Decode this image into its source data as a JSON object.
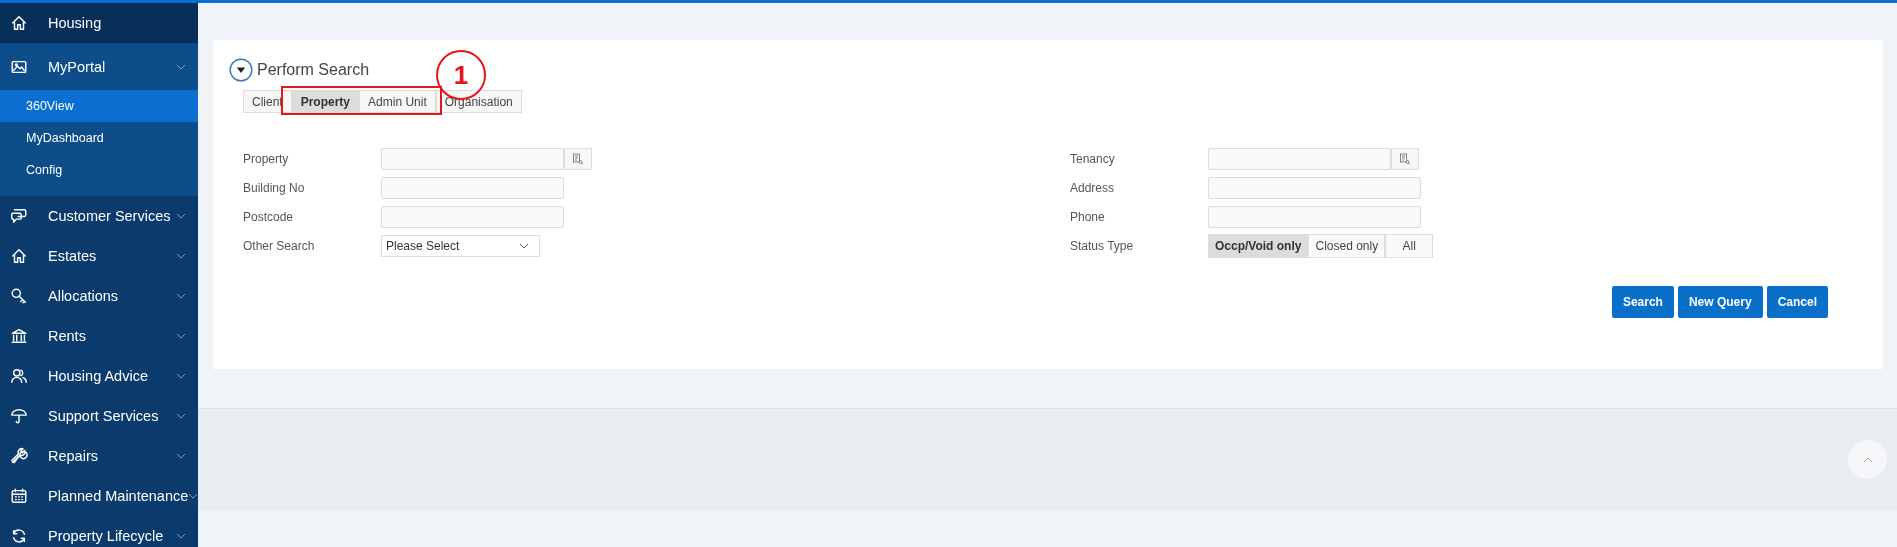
{
  "sidebar": {
    "items": [
      {
        "label": "Housing",
        "kind": "link"
      },
      {
        "label": "MyPortal",
        "kind": "group",
        "expanded": true,
        "children": [
          {
            "label": "360View",
            "selected": true
          },
          {
            "label": "MyDashboard",
            "selected": false
          },
          {
            "label": "Config",
            "selected": false
          }
        ]
      },
      {
        "label": "Customer Services",
        "kind": "group",
        "expanded": false
      },
      {
        "label": "Estates",
        "kind": "group",
        "expanded": false
      },
      {
        "label": "Allocations",
        "kind": "group",
        "expanded": false
      },
      {
        "label": "Rents",
        "kind": "group",
        "expanded": false
      },
      {
        "label": "Housing Advice",
        "kind": "group",
        "expanded": false
      },
      {
        "label": "Support Services",
        "kind": "group",
        "expanded": false
      },
      {
        "label": "Repairs",
        "kind": "group",
        "expanded": false
      },
      {
        "label": "Planned Maintenance",
        "kind": "group",
        "expanded": false
      },
      {
        "label": "Property Lifecycle",
        "kind": "group",
        "expanded": false
      }
    ]
  },
  "search_panel": {
    "title": "Perform Search",
    "expanded": true,
    "tabs": [
      {
        "label": "Client",
        "selected": false
      },
      {
        "label": "Property",
        "selected": true
      },
      {
        "label": "Admin Unit",
        "selected": false
      },
      {
        "label": "Organisation",
        "selected": false
      }
    ],
    "left_fields": [
      {
        "label": "Property",
        "kind": "lookup"
      },
      {
        "label": "Building No",
        "kind": "text"
      },
      {
        "label": "Postcode",
        "kind": "text"
      },
      {
        "label": "Other Search",
        "kind": "select",
        "value": "Please Select"
      }
    ],
    "right_fields": [
      {
        "label": "Tenancy",
        "kind": "lookup"
      },
      {
        "label": "Address",
        "kind": "text"
      },
      {
        "label": "Phone",
        "kind": "text"
      },
      {
        "label": "Status Type",
        "kind": "segmented",
        "options": [
          {
            "label": "Occp/Void only",
            "selected": true
          },
          {
            "label": "Closed only",
            "selected": false
          },
          {
            "label": "All",
            "selected": false
          }
        ]
      }
    ],
    "buttons": [
      "Search",
      "New Query",
      "Cancel"
    ]
  },
  "annotation": {
    "number": "1"
  }
}
